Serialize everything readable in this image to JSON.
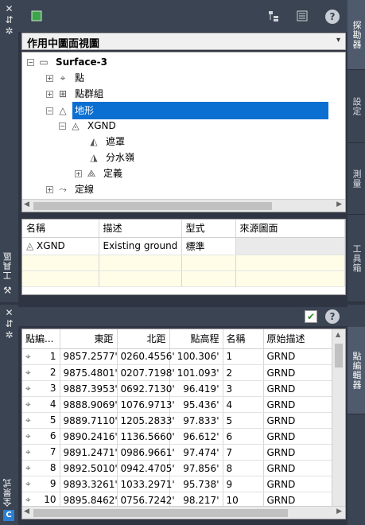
{
  "top_panel": {
    "strip_title": "工具區",
    "dropdown_value": "作用中圖面視圖",
    "tabs": [
      "探勘器",
      "設定",
      "測量",
      "工具箱"
    ],
    "tree": [
      {
        "label": "Surface-3",
        "expander": "−",
        "icon": "surface-icon"
      },
      {
        "label": "點",
        "expander": "+",
        "icon": "point-icon"
      },
      {
        "label": "點群組",
        "expander": "+",
        "icon": "point-group-icon"
      },
      {
        "label": "地形",
        "expander": "−",
        "icon": "surfaces-icon"
      },
      {
        "label": "XGND",
        "expander": "−",
        "icon": "surface-item-icon"
      },
      {
        "label": "遮罩",
        "expander": "",
        "icon": "mask-icon"
      },
      {
        "label": "分水嶺",
        "expander": "",
        "icon": "watershed-icon"
      },
      {
        "label": "定義",
        "expander": "+",
        "icon": "definition-icon"
      },
      {
        "label": "定線",
        "expander": "+",
        "icon": "alignment-icon"
      }
    ],
    "list_headers": [
      "名稱",
      "描述",
      "型式",
      "來源圖面"
    ],
    "list_rows": [
      [
        "XGND",
        "Existing ground",
        "標準",
        ""
      ]
    ]
  },
  "bottom_panel": {
    "strip_title": "全景式",
    "tab": "點編輯器",
    "headers": [
      "點編...",
      "東距",
      "北距",
      "點高程",
      "名稱",
      "原始描述"
    ],
    "rows": [
      [
        "1",
        "9857.2577'",
        "0260.4556'",
        "100.306'",
        "1",
        "GRND"
      ],
      [
        "2",
        "9875.4801'",
        "0207.7198'",
        "101.093'",
        "2",
        "GRND"
      ],
      [
        "3",
        "9887.3953'",
        "0692.7130'",
        "96.419'",
        "3",
        "GRND"
      ],
      [
        "4",
        "9888.9069'",
        "1076.9713'",
        "95.436'",
        "4",
        "GRND"
      ],
      [
        "5",
        "9889.7110'",
        "1205.2833'",
        "97.833'",
        "5",
        "GRND"
      ],
      [
        "6",
        "9890.2416'",
        "1136.5660'",
        "96.612'",
        "6",
        "GRND"
      ],
      [
        "7",
        "9891.2471'",
        "0986.9661'",
        "97.474'",
        "7",
        "GRND"
      ],
      [
        "8",
        "9892.5010'",
        "0942.4705'",
        "97.856'",
        "8",
        "GRND"
      ],
      [
        "9",
        "9893.3261'",
        "1033.2971'",
        "95.738'",
        "9",
        "GRND"
      ],
      [
        "10",
        "9895.8462'",
        "0756.7242'",
        "98.217'",
        "10",
        "GRND"
      ]
    ]
  },
  "icons": {
    "help": "?",
    "checkbox": "✔",
    "close": "✕",
    "pin": "⇵",
    "settings": "✲"
  }
}
